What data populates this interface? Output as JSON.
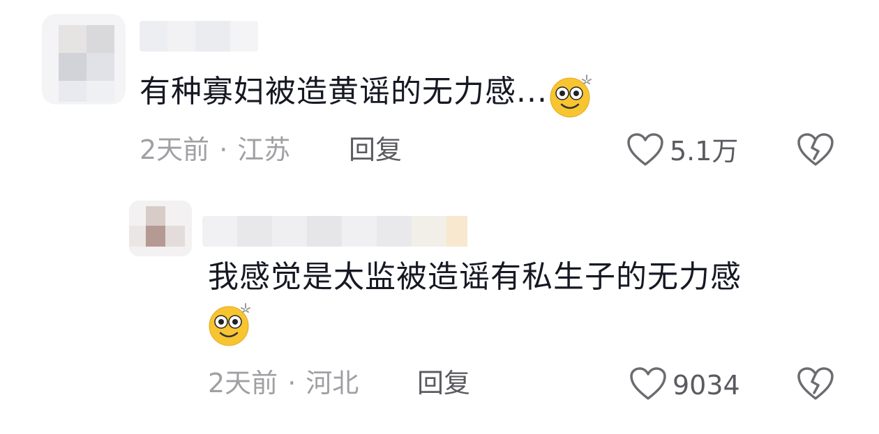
{
  "comments": [
    {
      "text": "有种寡妇被造黄谣的无力感...",
      "emoji": "dizzy-eyes-emoji",
      "time": "2天前",
      "separator": "·",
      "location": "江苏",
      "reply_label": "回复",
      "like_count": "5.1万"
    },
    {
      "text_line1": "我感觉是太监被造谣有私生子的无力感",
      "emoji": "dizzy-eyes-emoji",
      "time": "2天前",
      "separator": "·",
      "location": "河北",
      "reply_label": "回复",
      "like_count": "9034"
    }
  ],
  "icons": {
    "like": "heart-outline-icon",
    "dislike": "broken-heart-icon"
  },
  "colors": {
    "text_primary": "#161823",
    "meta_gray": "#a0a0a4",
    "action_gray": "#5a5a60",
    "emoji_yellow": "#f7c531"
  }
}
